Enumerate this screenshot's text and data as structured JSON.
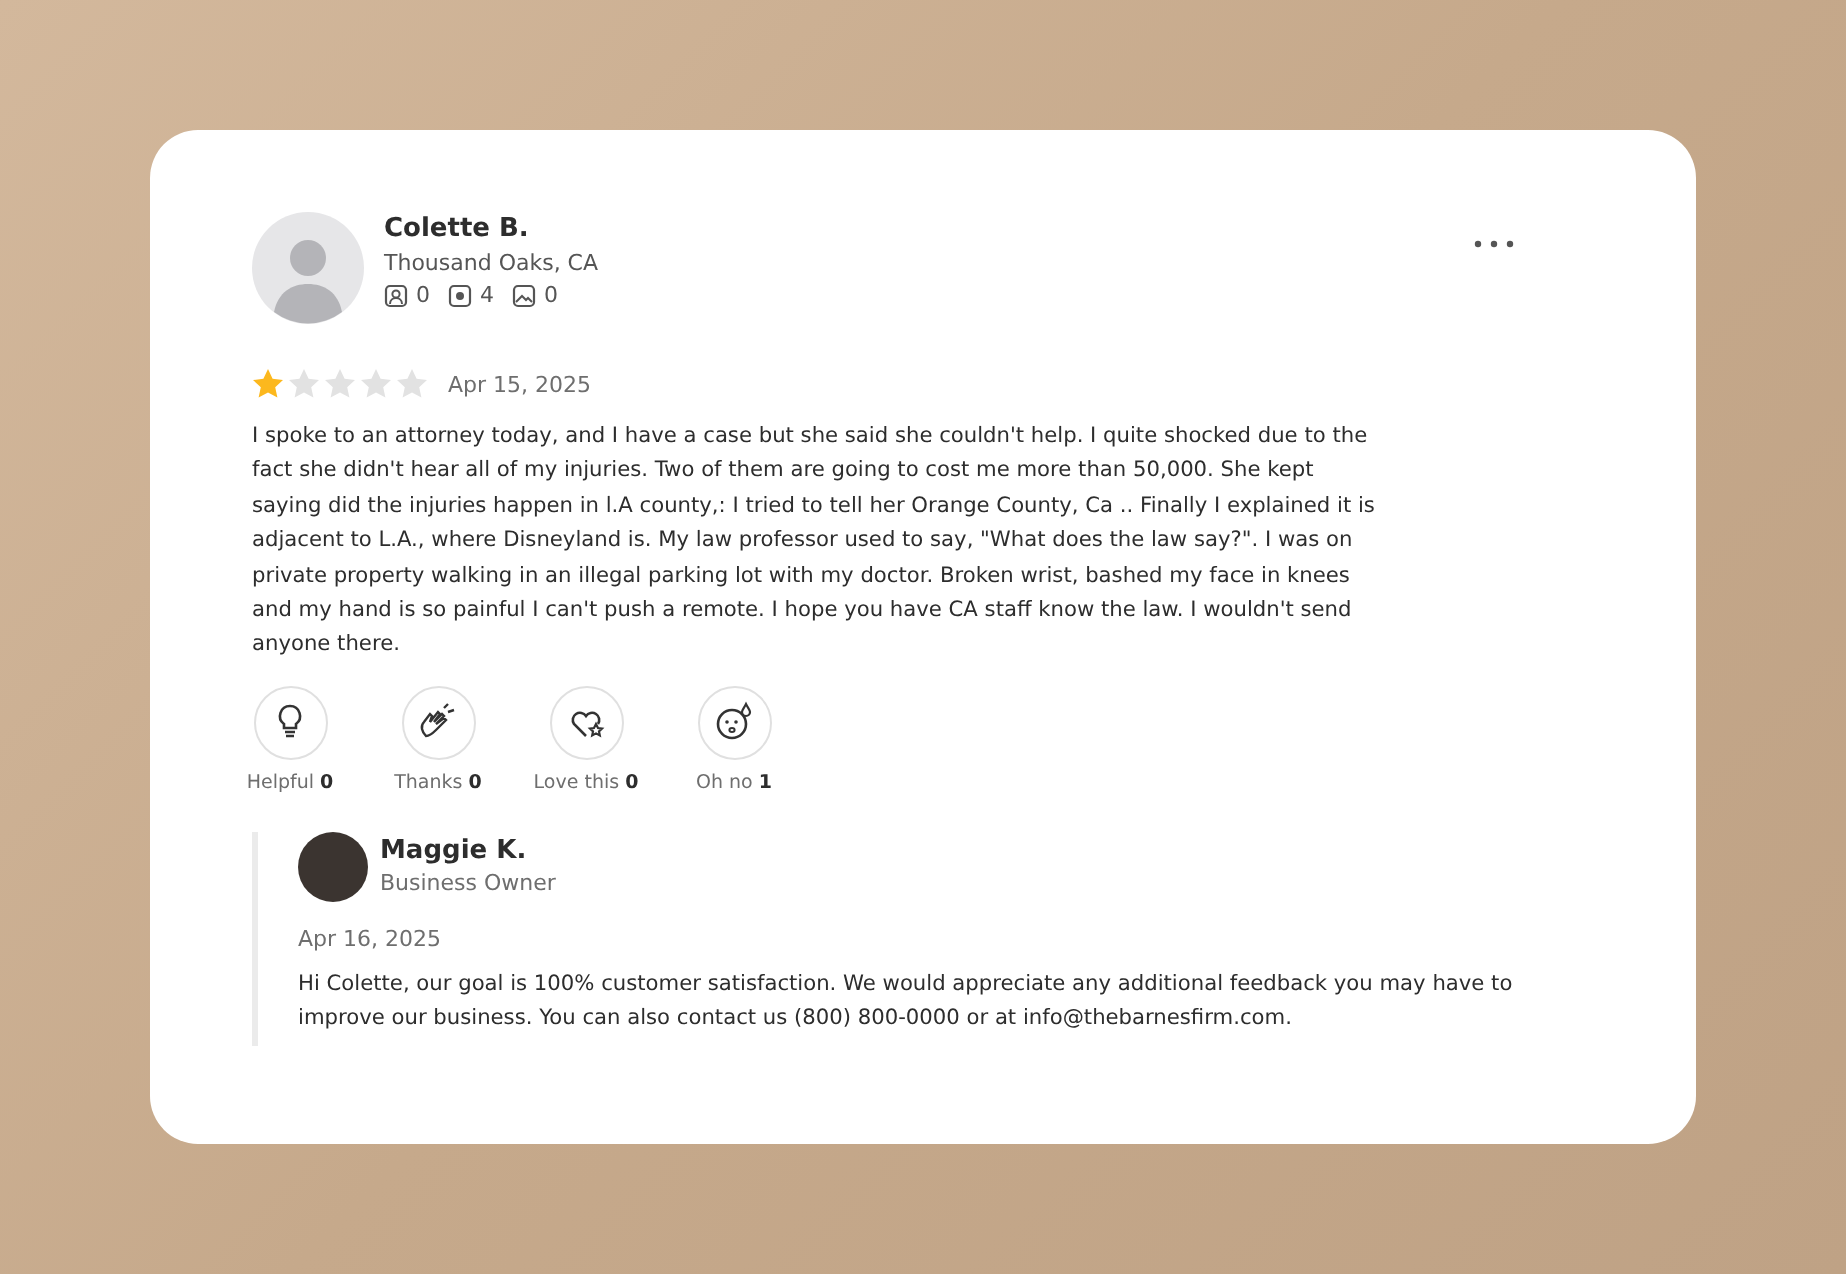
{
  "review": {
    "author": {
      "name": "Colette B.",
      "location": "Thousand Oaks, CA",
      "stats": [
        {
          "kind": "friends",
          "count": "0"
        },
        {
          "kind": "reviews",
          "count": "4"
        },
        {
          "kind": "photos",
          "count": "0"
        }
      ]
    },
    "stars": 1,
    "date": "Apr 15, 2025",
    "text": "I spoke to an attorney today, and I have a case but she said she couldn't help. I quite shocked due to the fact she didn't hear all of my injuries. Two of them are going to cost me more than 50,000. She kept saying did the injuries happen in l.A county,: I tried to tell her Orange County, Ca .. Finally I explained it is adjacent to L.A., where Disneyland is. My law professor used to say, \"What does the law say?\". I was on private property walking in an illegal parking lot with my doctor. Broken wrist, bashed my face in knees and my hand is so painful I can't push a remote. I hope you have CA staff know the law. I wouldn't send anyone there.",
    "reactions": [
      {
        "kind": "helpful",
        "label": "Helpful",
        "count": "0"
      },
      {
        "kind": "thanks",
        "label": "Thanks",
        "count": "0"
      },
      {
        "kind": "love",
        "label": "Love this",
        "count": "0"
      },
      {
        "kind": "ohno",
        "label": "Oh no",
        "count": "1"
      }
    ],
    "reply": {
      "name": "Maggie K.",
      "role": "Business Owner",
      "date": "Apr 16, 2025",
      "text": "Hi Colette, our goal is 100% customer satisfaction. We would appreciate any additional feedback you may have to improve our business. You can also contact us (800) 800-0000 or at info@thebarnesfirm.com."
    }
  }
}
